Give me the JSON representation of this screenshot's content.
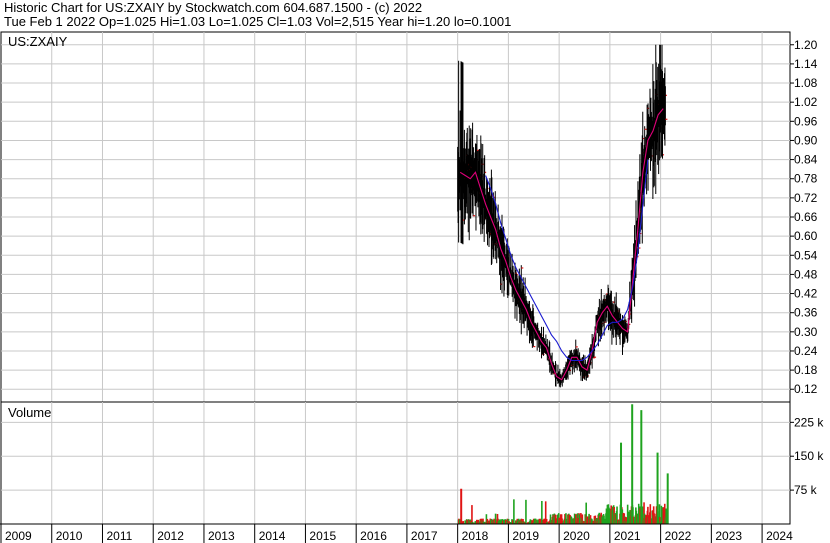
{
  "header": {
    "line1": "Historic Chart for US:ZXAIY by Stockwatch.com 604.687.1500 - (c) 2022",
    "line2": "Tue Feb  1 2022  Op=1.025  Hi=1.03  Lo=1.025  Cl=1.03  Vol=2,515  Year hi=1.20  lo=0.1001"
  },
  "colors": {
    "price_bar": "#000000",
    "ma_short": "#e0007a",
    "ma_long": "#1a1ad0",
    "vol_up": "#1fa31f",
    "vol_down": "#e01414",
    "grid": "#c8c8c8",
    "frame": "#000000"
  },
  "chart_data": [
    {
      "type": "line",
      "panel": "price",
      "title": "US:ZXAIY",
      "ylim": [
        0.08,
        1.24
      ],
      "yticks": [
        "1.20",
        "1.14",
        "1.08",
        "1.02",
        "0.96",
        "0.90",
        "0.84",
        "0.78",
        "0.72",
        "0.66",
        "0.60",
        "0.54",
        "0.48",
        "0.42",
        "0.36",
        "0.30",
        "0.24",
        "0.18",
        "0.12"
      ],
      "x_range": [
        2009.0,
        2024.55
      ],
      "series": [
        {
          "key": "ma_short",
          "x": [
            2018.05,
            2018.15,
            2018.25,
            2018.35,
            2018.45,
            2018.55,
            2018.65,
            2018.75,
            2018.85,
            2018.95,
            2019.05,
            2019.15,
            2019.25,
            2019.35,
            2019.45,
            2019.55,
            2019.65,
            2019.75,
            2019.85,
            2019.95,
            2020.05,
            2020.15,
            2020.25,
            2020.35,
            2020.45,
            2020.55,
            2020.65,
            2020.75,
            2020.85,
            2020.95,
            2021.05,
            2021.15,
            2021.25,
            2021.35,
            2021.45,
            2021.55,
            2021.65,
            2021.75,
            2021.85,
            2021.95,
            2022.05
          ],
          "y": [
            0.8,
            0.79,
            0.78,
            0.8,
            0.75,
            0.7,
            0.66,
            0.62,
            0.56,
            0.52,
            0.47,
            0.43,
            0.4,
            0.37,
            0.33,
            0.3,
            0.27,
            0.25,
            0.2,
            0.16,
            0.15,
            0.18,
            0.22,
            0.22,
            0.19,
            0.18,
            0.24,
            0.33,
            0.36,
            0.38,
            0.35,
            0.33,
            0.31,
            0.3,
            0.46,
            0.62,
            0.8,
            0.9,
            0.93,
            0.98,
            1.0
          ]
        },
        {
          "key": "ma_long",
          "x": [
            2018.55,
            2018.65,
            2018.75,
            2018.85,
            2018.95,
            2019.05,
            2019.15,
            2019.25,
            2019.35,
            2019.45,
            2019.55,
            2019.65,
            2019.75,
            2019.85,
            2019.95,
            2020.05,
            2020.15,
            2020.25,
            2020.35,
            2020.45,
            2020.55,
            2020.65,
            2020.75,
            2020.85,
            2020.95,
            2021.05,
            2021.15,
            2021.25,
            2021.35,
            2021.45,
            2021.55,
            2021.65,
            2021.75
          ],
          "y": [
            0.79,
            0.75,
            0.7,
            0.64,
            0.59,
            0.54,
            0.5,
            0.47,
            0.44,
            0.41,
            0.38,
            0.35,
            0.32,
            0.29,
            0.27,
            0.24,
            0.22,
            0.21,
            0.21,
            0.21,
            0.22,
            0.24,
            0.26,
            0.29,
            0.32,
            0.33,
            0.33,
            0.34,
            0.37,
            0.44,
            0.55,
            0.7,
            0.84
          ]
        }
      ]
    },
    {
      "type": "bar",
      "panel": "volume",
      "title": "Volume",
      "ylim": [
        0,
        270000
      ],
      "yticks": [
        "225 k",
        "150 k",
        "75 k"
      ],
      "highlights": [
        {
          "x": 2018.05,
          "value": 78000,
          "dir": "down"
        },
        {
          "x": 2021.2,
          "value": 180000,
          "dir": "up"
        },
        {
          "x": 2021.42,
          "value": 265000,
          "dir": "up"
        },
        {
          "x": 2021.6,
          "value": 252000,
          "dir": "up"
        },
        {
          "x": 2021.92,
          "value": 158000,
          "dir": "up"
        },
        {
          "x": 2022.12,
          "value": 112000,
          "dir": "up"
        }
      ]
    }
  ],
  "x_axis": {
    "labels": [
      "2009",
      "2010",
      "2011",
      "2012",
      "2013",
      "2014",
      "2015",
      "2016",
      "2017",
      "2018",
      "2019",
      "2020",
      "2021",
      "2022",
      "2023",
      "2024"
    ]
  }
}
